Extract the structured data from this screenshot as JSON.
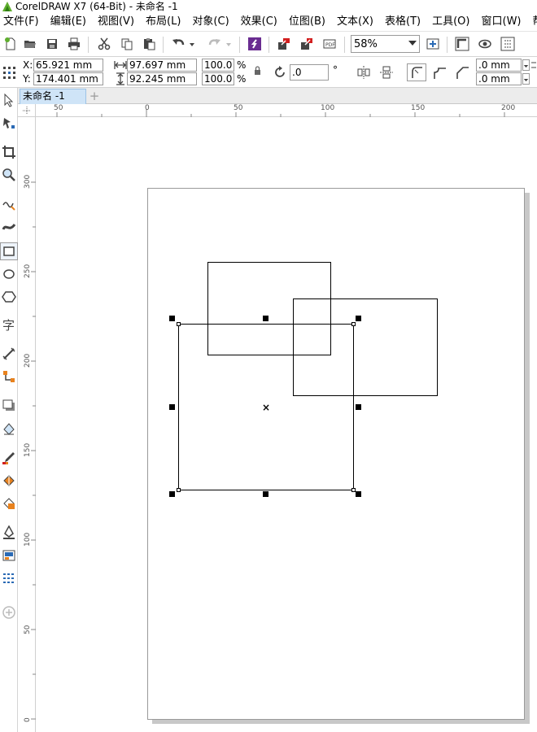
{
  "window": {
    "title": "CorelDRAW X7 (64-Bit) - 未命名 -1"
  },
  "menu": [
    {
      "label": "文件(F)"
    },
    {
      "label": "编辑(E)"
    },
    {
      "label": "视图(V)"
    },
    {
      "label": "布局(L)"
    },
    {
      "label": "对象(C)"
    },
    {
      "label": "效果(C)"
    },
    {
      "label": "位图(B)"
    },
    {
      "label": "文本(X)"
    },
    {
      "label": "表格(T)"
    },
    {
      "label": "工具(O)"
    },
    {
      "label": "窗口(W)"
    },
    {
      "label": "帮"
    }
  ],
  "toolbar": {
    "zoom_value": "58%",
    "icons": [
      "new-document-icon",
      "open-icon",
      "save-icon",
      "print-icon",
      "cut-icon",
      "copy-icon",
      "paste-icon",
      "undo-icon",
      "redo-icon",
      "corel-connect-icon",
      "import-icon",
      "export-icon",
      "publish-pdf-icon",
      "zoom-to-page-icon",
      "snap-to-icon",
      "view-icon",
      "options-icon"
    ]
  },
  "properties": {
    "x_label": "X:",
    "x_value": "65.921 mm",
    "y_label": "Y:",
    "y_value": "174.401 mm",
    "width_value": "97.697 mm",
    "height_value": "92.245 mm",
    "scale_w": "100.0",
    "scale_h": "100.0",
    "percent_w": "%",
    "percent_h": "%",
    "rotation_value": ".0",
    "degree_symbol": "°",
    "corner_w": ".0 mm",
    "corner_h": ".0 mm"
  },
  "document_tab": {
    "label": "未命名 -1",
    "add_symbol": "+"
  },
  "ruler": {
    "horizontal_labels": [
      "50",
      "0",
      "50",
      "100",
      "150",
      "200"
    ],
    "vertical_labels": [
      "300",
      "250",
      "200",
      "150",
      "100",
      "50",
      "0"
    ]
  },
  "selection": {
    "center_mark": "×"
  },
  "colors": {
    "tab_active": "#cfe4f7",
    "brand_purple": "#6a2c91",
    "accent_red": "#d21f1f",
    "accent_orange": "#e8821e"
  }
}
